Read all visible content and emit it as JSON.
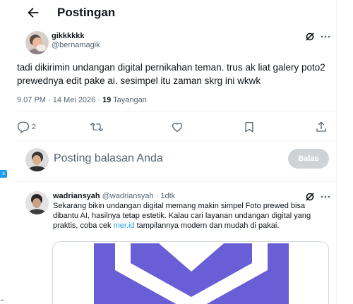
{
  "header": {
    "title": "Postingan"
  },
  "left_strip": {
    "badge": "s",
    "dots": "..."
  },
  "post": {
    "author": {
      "name": "gikkkkkk",
      "handle": "@bernamagik"
    },
    "text": "tadi dikirimin undangan digital pernikahan teman. trus ak liat galery poto2 prewednya edit pake ai. sesimpel itu zaman skrg ini  wkwk",
    "meta": {
      "time_date": "9.07 PM · 14 Mei 2026 · ",
      "views_count": "19",
      "views_label": " Tayangan"
    },
    "actions": {
      "reply_count": "2"
    }
  },
  "composer": {
    "placeholder": "Posting balasan Anda",
    "button_label": "Balas"
  },
  "reply": {
    "name": "wadriansyah",
    "handle": " @wadriansyah · 1dtk",
    "text_before_link": "Sekarang bikin undangan digital memang makin simpel Foto prewed bisa dibantu AI, hasilnya tetap estetik. Kalau cari layanan undangan digital yang praktis, coba cek ",
    "link_text": "mer.id",
    "text_after_link": " tampilannya modern dan mudah di pakai."
  },
  "colors": {
    "accent": "#1d9bf0",
    "secondary_text": "#536471",
    "logo_purple": "#6a5ed6",
    "button_disabled": "#d0d3d5"
  },
  "icons": [
    "back-arrow-icon",
    "grok-icon",
    "more-icon",
    "reply-icon",
    "repost-icon",
    "like-icon",
    "bookmark-icon",
    "share-icon"
  ]
}
